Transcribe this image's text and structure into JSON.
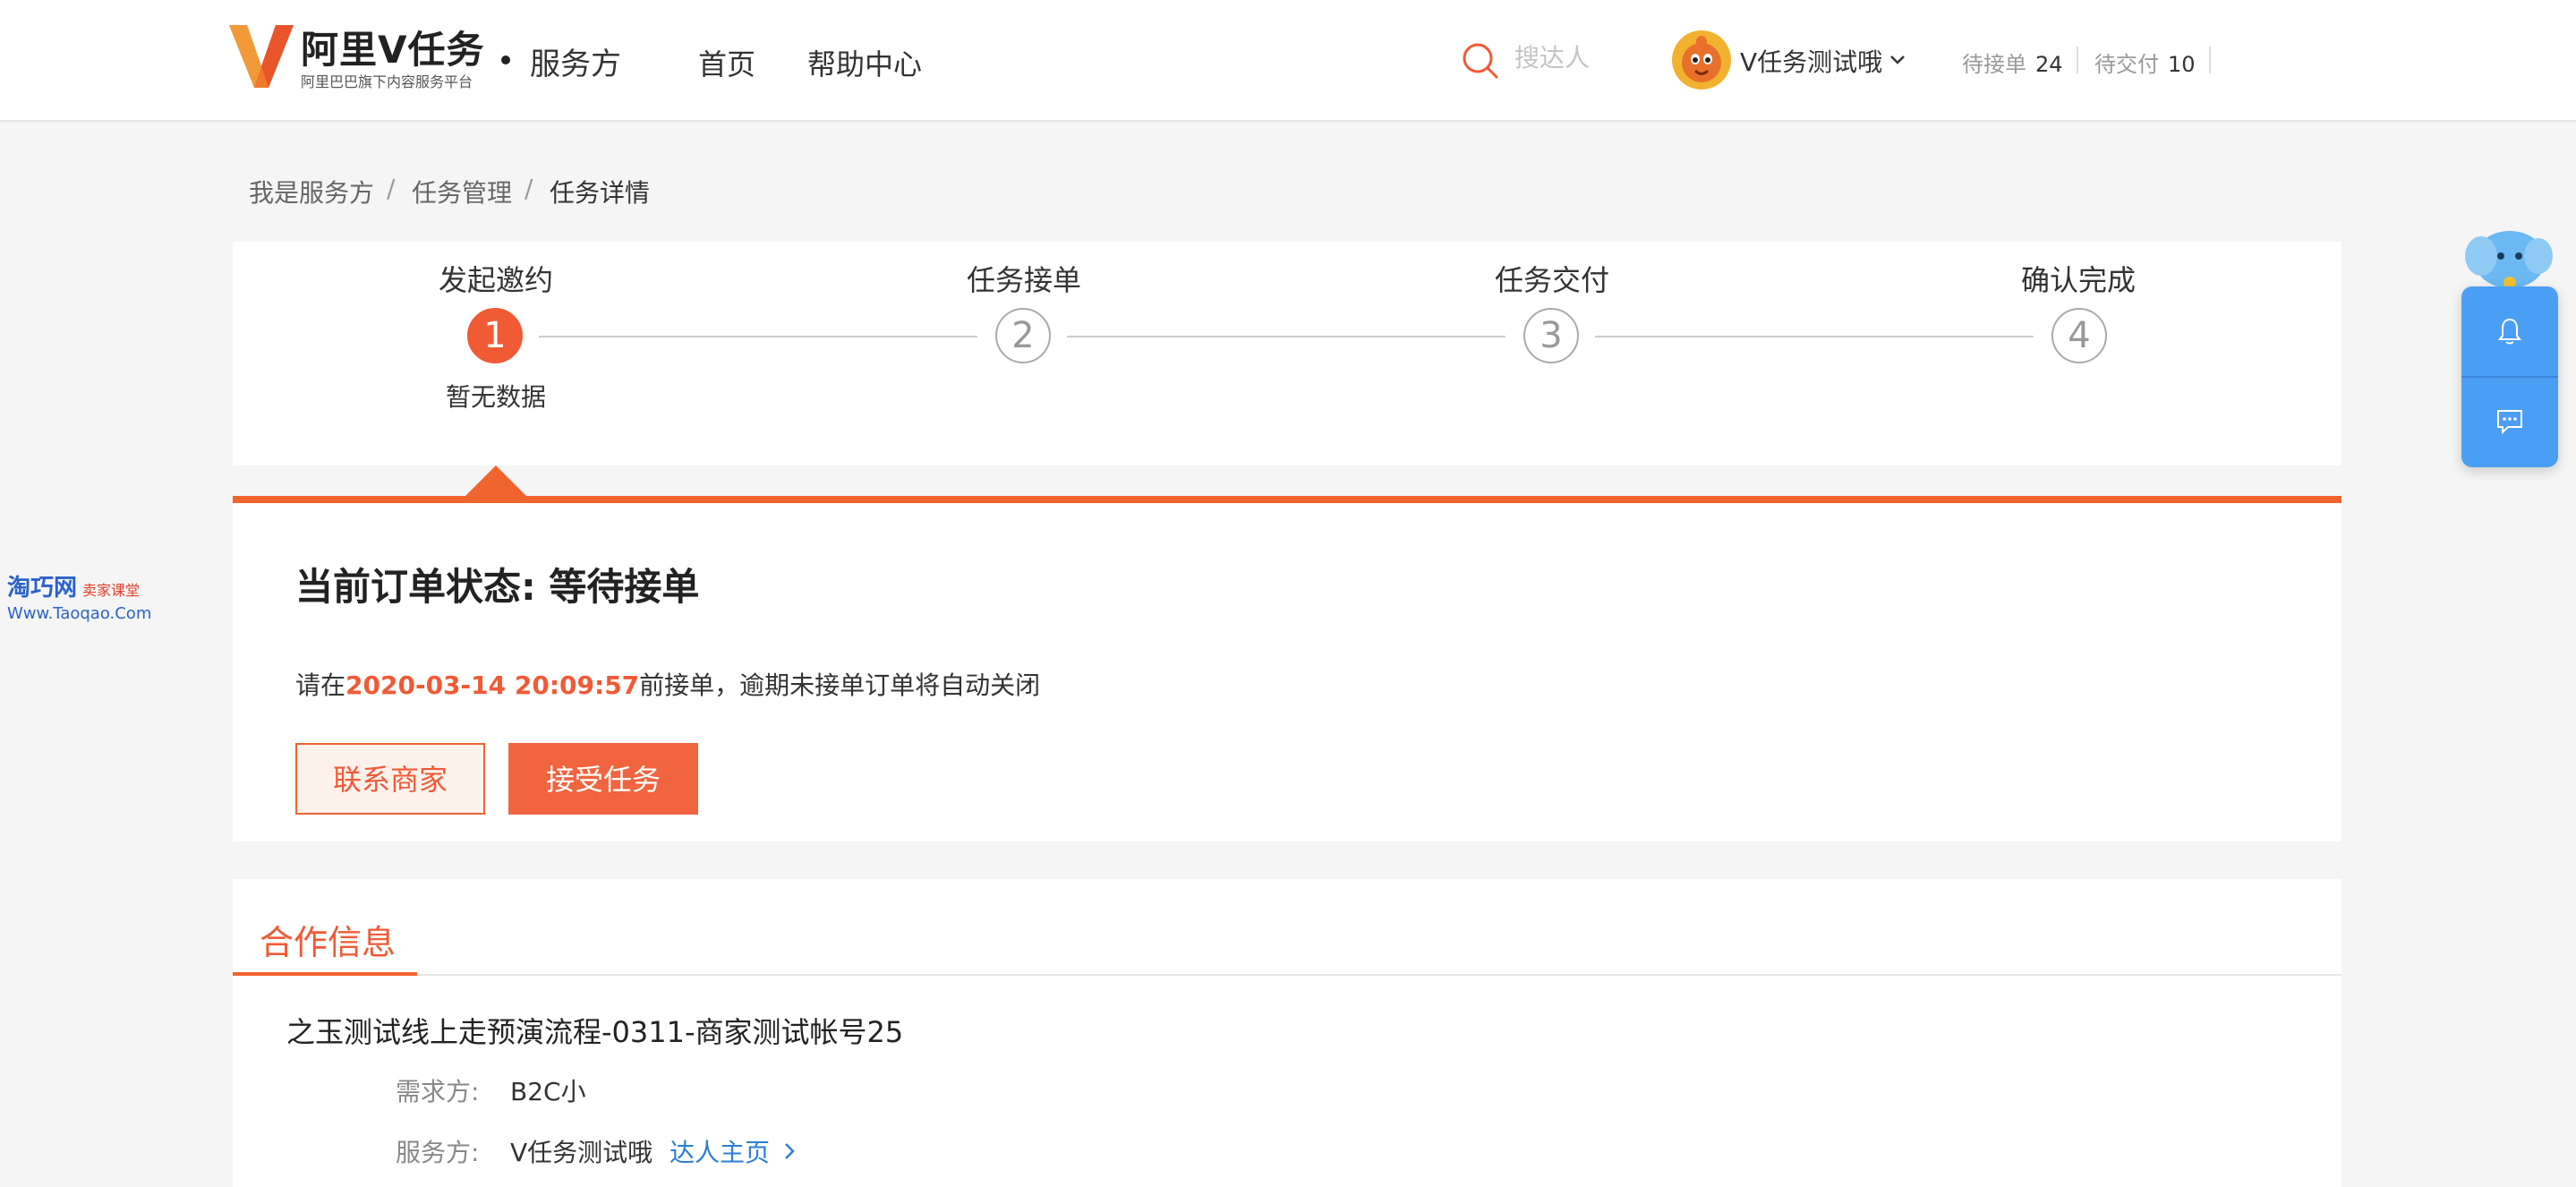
{
  "header": {
    "logo_title": "阿里V任务",
    "logo_subtitle": "阿里巴巴旗下内容服务平台",
    "role": "服务方",
    "nav": [
      "首页",
      "帮助中心"
    ],
    "search_placeholder": "搜达人",
    "user_name": "V任务测试哦",
    "stats": [
      {
        "label": "待接单",
        "count": "24"
      },
      {
        "label": "待交付",
        "count": "10"
      }
    ]
  },
  "breadcrumb": [
    "我是服务方",
    "任务管理",
    "任务详情"
  ],
  "breadcrumb_separator": "/",
  "steps": [
    {
      "label": "发起邀约",
      "number": "1",
      "active": true,
      "note": "暂无数据"
    },
    {
      "label": "任务接单",
      "number": "2",
      "active": false
    },
    {
      "label": "任务交付",
      "number": "3",
      "active": false
    },
    {
      "label": "确认完成",
      "number": "4",
      "active": false
    }
  ],
  "status": {
    "title": "当前订单状态: 等待接单",
    "message_prefix": "请在",
    "deadline": "2020-03-14 20:09:57",
    "message_suffix": "前接单，逾期未接单订单将自动关闭",
    "contact_button": "联系商家",
    "accept_button": "接受任务"
  },
  "cooperation": {
    "tab": "合作信息",
    "task_name": "之玉测试线上走预演流程-0311-商家测试帐号25",
    "demand_label": "需求方:",
    "demand_value": "B2C小",
    "service_label": "服务方:",
    "service_value": "V任务测试哦",
    "talent_link": "达人主页"
  },
  "watermark": {
    "site": "淘巧网",
    "tag": "卖家课堂",
    "url": "Www.Taoqao.Com"
  },
  "colors": {
    "accent": "#f05a35",
    "link": "#2a7fd4",
    "float_panel": "#4a9ff5"
  }
}
